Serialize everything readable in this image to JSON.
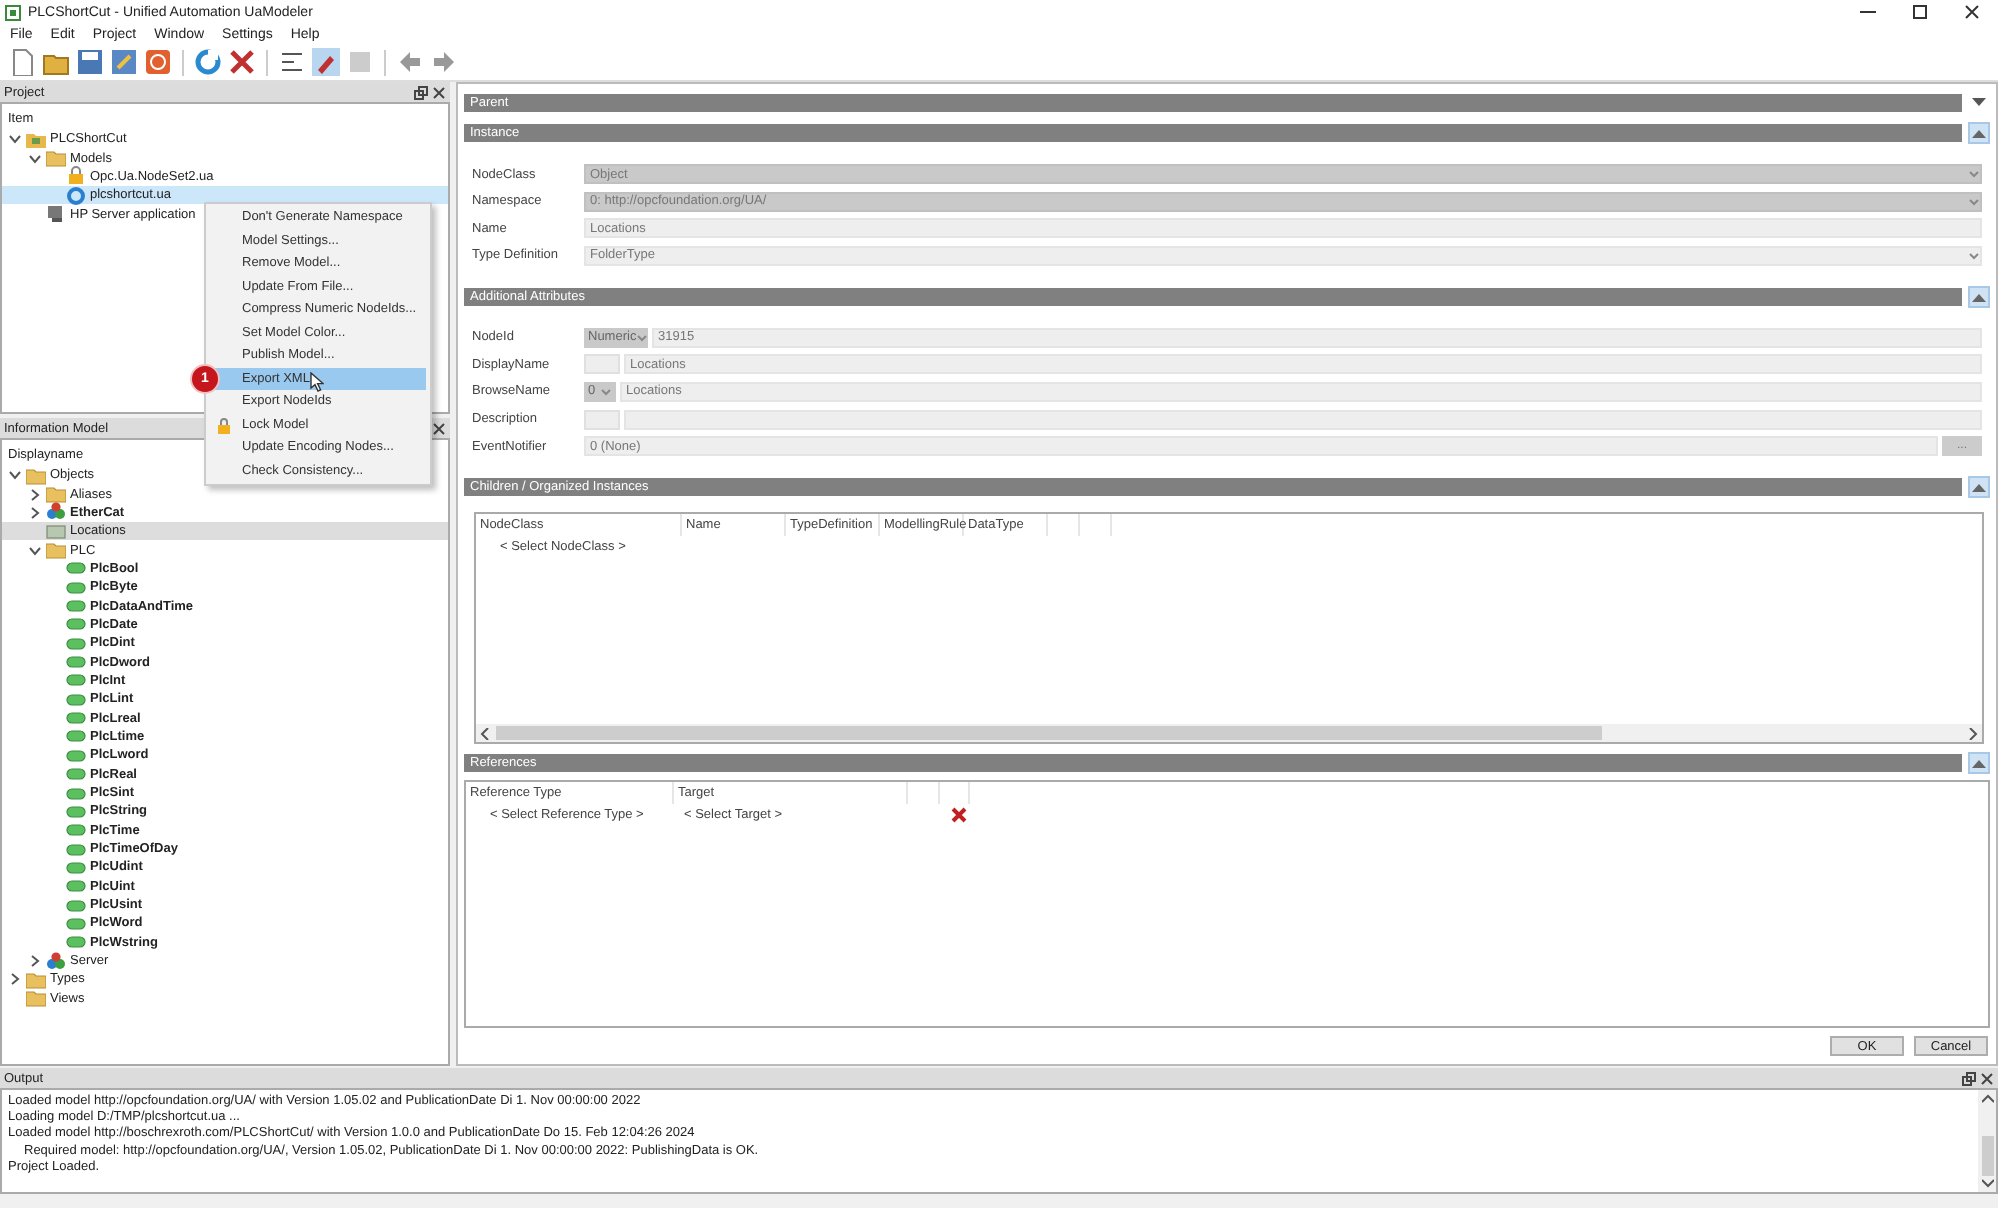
{
  "window": {
    "title": "PLCShortCut - Unified Automation UaModeler"
  },
  "menu": [
    "File",
    "Edit",
    "Project",
    "Window",
    "Settings",
    "Help"
  ],
  "project_panel": {
    "title": "Project",
    "header": "Item",
    "tree": [
      {
        "label": "PLCShortCut",
        "kind": "project",
        "expanded": true,
        "selected": false,
        "children": [
          {
            "label": "Models",
            "kind": "folder",
            "expanded": true,
            "selected": false,
            "children": [
              {
                "label": "Opc.Ua.NodeSet2.ua",
                "kind": "locked-model",
                "selected": false
              },
              {
                "label": "plcshortcut.ua",
                "kind": "model",
                "selected": true
              }
            ]
          },
          {
            "label": "HP Server application",
            "kind": "server-app",
            "selected": false
          }
        ]
      }
    ]
  },
  "context_menu": {
    "items": [
      {
        "label": "Don't Generate Namespace",
        "kind": "plain",
        "selected": false
      },
      {
        "label": "Model Settings...",
        "kind": "plain",
        "selected": false
      },
      {
        "label": "Remove Model...",
        "kind": "plain",
        "selected": false
      },
      {
        "label": "Update From File...",
        "kind": "plain",
        "selected": false
      },
      {
        "label": "Compress Numeric NodeIds...",
        "kind": "plain",
        "selected": false
      },
      {
        "label": "Set Model Color...",
        "kind": "plain",
        "selected": false
      },
      {
        "label": "Publish Model...",
        "kind": "plain",
        "selected": false
      },
      {
        "label": "Export XML",
        "kind": "plain",
        "selected": true,
        "badge": "1"
      },
      {
        "label": "Export NodeIds",
        "kind": "plain",
        "selected": false
      },
      {
        "label": "Lock Model",
        "kind": "lock",
        "selected": false
      },
      {
        "label": "Update Encoding Nodes...",
        "kind": "plain",
        "selected": false
      },
      {
        "label": "Check Consistency...",
        "kind": "plain",
        "selected": false
      }
    ]
  },
  "info_panel": {
    "title": "Information Model",
    "header": "Displayname",
    "tree": [
      {
        "label": "Objects",
        "kind": "folder",
        "bold": false,
        "expanded": true,
        "selected": false,
        "children": [
          {
            "label": "Aliases",
            "kind": "folder",
            "bold": false,
            "expanded": false,
            "selected": false
          },
          {
            "label": "EtherCat",
            "kind": "object",
            "bold": true,
            "expanded": false,
            "selected": false
          },
          {
            "label": "Locations",
            "kind": "object-folder",
            "bold": false,
            "selected": true
          },
          {
            "label": "PLC",
            "kind": "folder",
            "bold": false,
            "expanded": true,
            "selected": false,
            "children": [
              {
                "label": "PlcBool",
                "kind": "variable",
                "bold": true,
                "selected": false
              },
              {
                "label": "PlcByte",
                "kind": "variable",
                "bold": true,
                "selected": false
              },
              {
                "label": "PlcDataAndTime",
                "kind": "variable",
                "bold": true,
                "selected": false
              },
              {
                "label": "PlcDate",
                "kind": "variable",
                "bold": true,
                "selected": false
              },
              {
                "label": "PlcDint",
                "kind": "variable",
                "bold": true,
                "selected": false
              },
              {
                "label": "PlcDword",
                "kind": "variable",
                "bold": true,
                "selected": false
              },
              {
                "label": "PlcInt",
                "kind": "variable",
                "bold": true,
                "selected": false
              },
              {
                "label": "PlcLint",
                "kind": "variable",
                "bold": true,
                "selected": false
              },
              {
                "label": "PlcLreal",
                "kind": "variable",
                "bold": true,
                "selected": false
              },
              {
                "label": "PlcLtime",
                "kind": "variable",
                "bold": true,
                "selected": false
              },
              {
                "label": "PlcLword",
                "kind": "variable",
                "bold": true,
                "selected": false
              },
              {
                "label": "PlcReal",
                "kind": "variable",
                "bold": true,
                "selected": false
              },
              {
                "label": "PlcSint",
                "kind": "variable",
                "bold": true,
                "selected": false
              },
              {
                "label": "PlcString",
                "kind": "variable",
                "bold": true,
                "selected": false
              },
              {
                "label": "PlcTime",
                "kind": "variable",
                "bold": true,
                "selected": false
              },
              {
                "label": "PlcTimeOfDay",
                "kind": "variable",
                "bold": true,
                "selected": false
              },
              {
                "label": "PlcUdint",
                "kind": "variable",
                "bold": true,
                "selected": false
              },
              {
                "label": "PlcUint",
                "kind": "variable",
                "bold": true,
                "selected": false
              },
              {
                "label": "PlcUsint",
                "kind": "variable",
                "bold": true,
                "selected": false
              },
              {
                "label": "PlcWord",
                "kind": "variable",
                "bold": true,
                "selected": false
              },
              {
                "label": "PlcWstring",
                "kind": "variable",
                "bold": true,
                "selected": false
              }
            ]
          },
          {
            "label": "Server",
            "kind": "object",
            "bold": false,
            "expanded": false,
            "selected": false
          }
        ]
      },
      {
        "label": "Types",
        "kind": "folder",
        "bold": false,
        "expanded": false,
        "selected": false
      },
      {
        "label": "Views",
        "kind": "folder",
        "bold": false,
        "selected": false
      }
    ]
  },
  "sections": [
    {
      "title": "Parent",
      "kind": "empty",
      "collapsed": true
    },
    {
      "title": "Instance",
      "kind": "fields",
      "collapsed": false,
      "fields": [
        {
          "label": "NodeClass",
          "kind": "combo",
          "value": "Object"
        },
        {
          "label": "Namespace",
          "kind": "combo",
          "value": "0: http://opcfoundation.org/UA/"
        },
        {
          "label": "Name",
          "kind": "text",
          "value": "Locations"
        },
        {
          "label": "Type Definition",
          "kind": "light-combo",
          "value": "FolderType"
        }
      ]
    },
    {
      "title": "Additional Attributes",
      "kind": "fields",
      "collapsed": false,
      "fields": [
        {
          "label": "NodeId",
          "kind": "prefixed",
          "prefix": "Numeric",
          "value": "31915"
        },
        {
          "label": "DisplayName",
          "kind": "boxed",
          "value": "Locations"
        },
        {
          "label": "BrowseName",
          "kind": "prefixed",
          "prefix": "0",
          "value": "Locations"
        },
        {
          "label": "Description",
          "kind": "boxed"
        },
        {
          "label": "EventNotifier",
          "kind": "button",
          "value": "0 (None)",
          "button": "..."
        }
      ]
    },
    {
      "title": "Children / Organized Instances",
      "kind": "table",
      "collapsed": false,
      "columns": [
        "NodeClass",
        "Name",
        "TypeDefinition",
        "ModellingRule",
        "DataType"
      ],
      "rows": [
        [
          "< Select NodeClass >"
        ]
      ]
    },
    {
      "title": "References",
      "kind": "references",
      "collapsed": false,
      "columns": [
        "Reference Type",
        "Target"
      ],
      "rows": [
        [
          "< Select Reference Type >",
          "< Select Target >"
        ]
      ]
    }
  ],
  "buttons": [
    "OK",
    "Cancel"
  ],
  "output": {
    "title": "Output",
    "lines": [
      {
        "text": "Loaded model http://opcfoundation.org/UA/ with Version 1.05.02 and PublicationDate Di 1. Nov 00:00:00 2022",
        "indent": false
      },
      {
        "text": "Loading model D:/TMP/plcshortcut.ua ...",
        "indent": false
      },
      {
        "text": "Loaded model http://boschrexroth.com/PLCShortCut/ with Version 1.0.0 and PublicationDate Do 15. Feb 12:04:26 2024",
        "indent": false
      },
      {
        "text": "Required model: http://opcfoundation.org/UA/, Version 1.05.02, PublicationDate Di 1. Nov 00:00:00 2022:  PublishingData is OK.",
        "indent": true
      },
      {
        "text": "Project Loaded.",
        "indent": false
      }
    ]
  }
}
